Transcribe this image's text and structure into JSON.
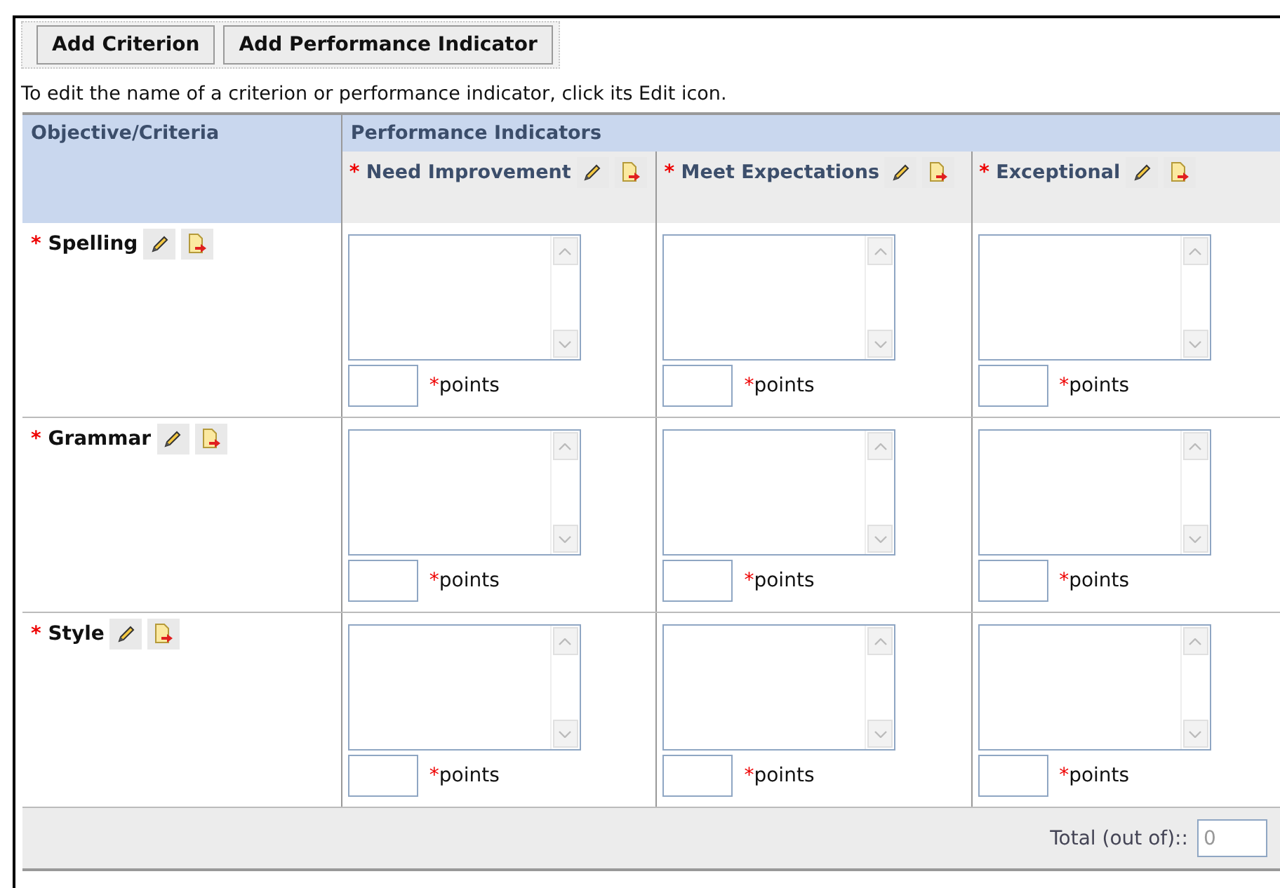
{
  "toolbar": {
    "buttons": [
      "Add Criterion",
      "Add Performance Indicator"
    ]
  },
  "instruction": "To edit the name of a criterion or performance indicator, click its Edit icon.",
  "table": {
    "criteria_heading": "Objective/Criteria",
    "indicators_heading": "Performance Indicators",
    "indicators": [
      {
        "mark": "*",
        "name": "Need Improvement"
      },
      {
        "mark": "*",
        "name": "Meet Expectations"
      },
      {
        "mark": "*",
        "name": "Exceptional"
      }
    ],
    "rows": [
      {
        "mark": "*",
        "name": "Spelling",
        "cells": [
          {
            "mark": "*",
            "label": "points"
          },
          {
            "mark": "*",
            "label": "points"
          },
          {
            "mark": "*",
            "label": "points"
          }
        ]
      },
      {
        "mark": "*",
        "name": "Grammar",
        "cells": [
          {
            "mark": "*",
            "label": "points"
          },
          {
            "mark": "*",
            "label": "points"
          },
          {
            "mark": "*",
            "label": "points"
          }
        ]
      },
      {
        "mark": "*",
        "name": "Style",
        "cells": [
          {
            "mark": "*",
            "label": "points"
          },
          {
            "mark": "*",
            "label": "points"
          },
          {
            "mark": "*",
            "label": "points"
          }
        ]
      }
    ]
  },
  "total": {
    "label": "Total (out of)::",
    "value": "0",
    "disabled": true
  }
}
